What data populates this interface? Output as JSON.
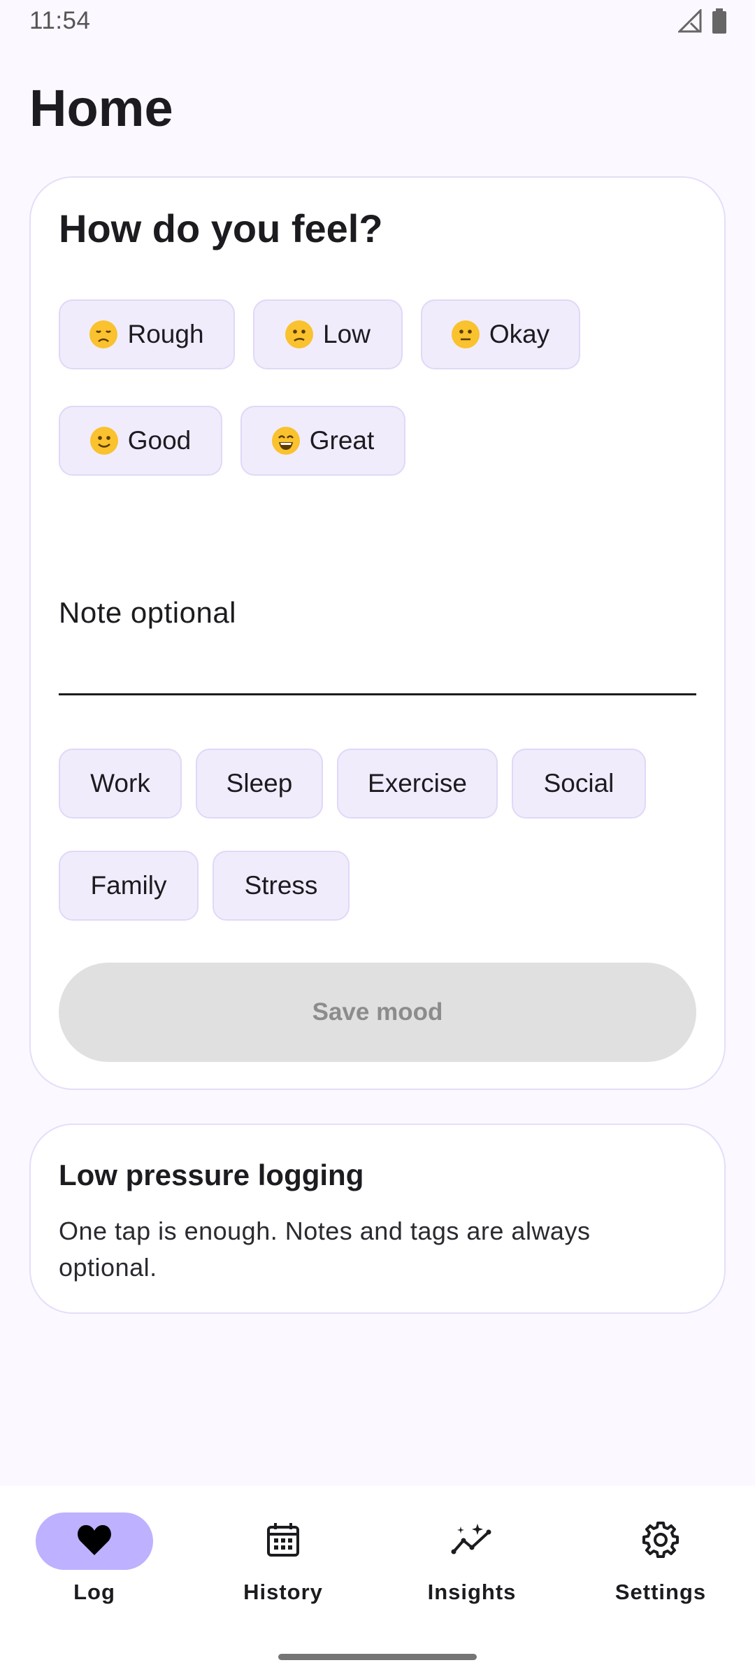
{
  "status_bar": {
    "time": "11:54"
  },
  "page_title": "Home",
  "mood_card": {
    "heading": "How do you feel?",
    "moods": [
      {
        "label": "Rough",
        "icon": "disappointed-face-icon"
      },
      {
        "label": "Low",
        "icon": "confused-face-icon"
      },
      {
        "label": "Okay",
        "icon": "neutral-face-icon"
      },
      {
        "label": "Good",
        "icon": "slightly-smiling-face-icon"
      },
      {
        "label": "Great",
        "icon": "grinning-face-icon"
      }
    ],
    "note_label": "Note optional",
    "tags": [
      "Work",
      "Sleep",
      "Exercise",
      "Social",
      "Family",
      "Stress"
    ],
    "save_label": "Save mood"
  },
  "info_card": {
    "title": "Low pressure logging",
    "body": "One tap is enough. Notes and tags are always optional."
  },
  "bottom_nav": {
    "items": [
      {
        "label": "Log",
        "icon": "heart-icon",
        "active": true
      },
      {
        "label": "History",
        "icon": "calendar-icon",
        "active": false
      },
      {
        "label": "Insights",
        "icon": "insights-icon",
        "active": false
      },
      {
        "label": "Settings",
        "icon": "gear-icon",
        "active": false
      }
    ]
  },
  "colors": {
    "background": "#fcf8ff",
    "chip": "#f1ecfc",
    "active_nav": "#beb1ff",
    "disabled_button": "#e0e0e0"
  }
}
